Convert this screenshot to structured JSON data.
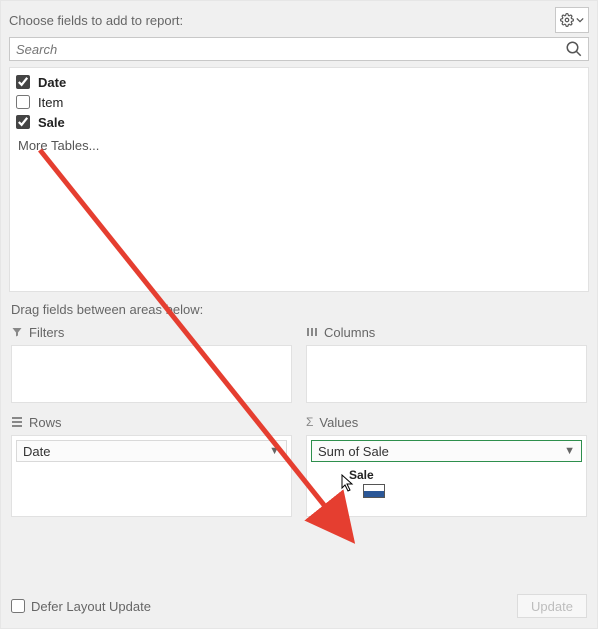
{
  "header": {
    "title": "Choose fields to add to report:",
    "gear_icon": "gear",
    "dropdown_icon": "chevron-down"
  },
  "search": {
    "placeholder": "Search"
  },
  "fields": {
    "items": [
      {
        "label": "Date",
        "checked": true,
        "bold": true
      },
      {
        "label": "Item",
        "checked": false,
        "bold": false
      },
      {
        "label": "Sale",
        "checked": true,
        "bold": true
      }
    ],
    "more_label": "More Tables..."
  },
  "areas": {
    "prompt": "Drag fields between areas below:",
    "filters_label": "Filters",
    "columns_label": "Columns",
    "rows_label": "Rows",
    "values_label": "Values",
    "rows_chip": "Date",
    "values_chip": "Sum of Sale",
    "drag_ghost": "Sale"
  },
  "footer": {
    "defer_label": "Defer Layout Update",
    "update_label": "Update"
  },
  "annotation": {
    "arrow_color": "#e53e30"
  }
}
